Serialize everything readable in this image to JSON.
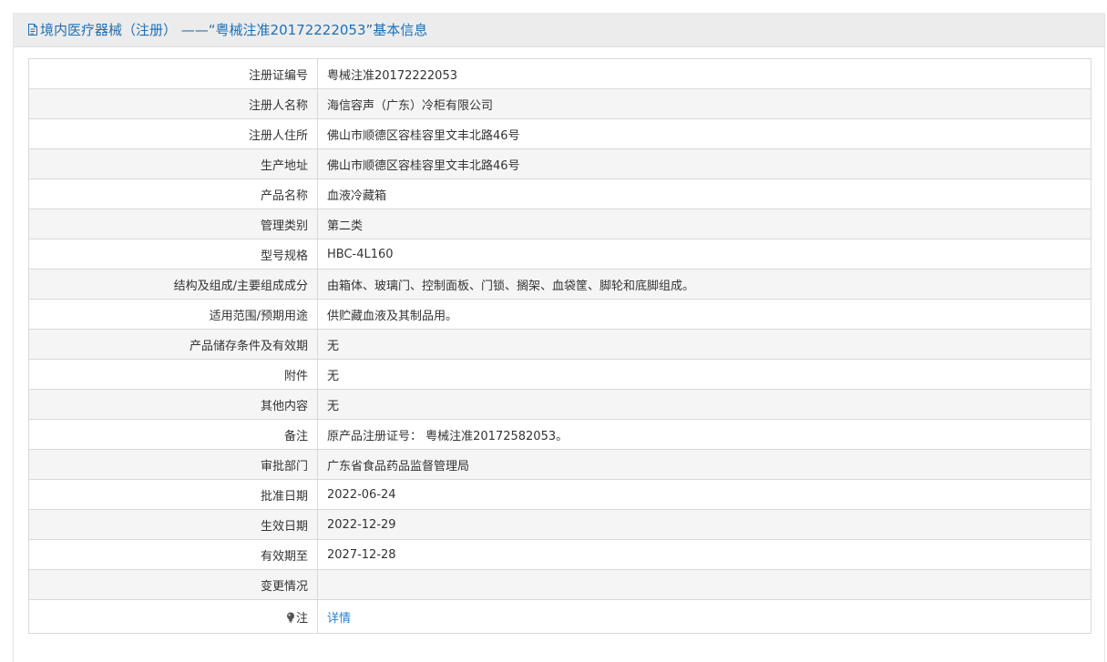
{
  "header": {
    "icon": "document-icon",
    "title": "境内医疗器械（注册） ——“粤械注准20172222053”基本信息"
  },
  "rows": [
    {
      "label": "注册证编号",
      "value": "粤械注准20172222053"
    },
    {
      "label": "注册人名称",
      "value": "海信容声（广东）冷柜有限公司"
    },
    {
      "label": "注册人住所",
      "value": "佛山市顺德区容桂容里文丰北路46号"
    },
    {
      "label": "生产地址",
      "value": "佛山市顺德区容桂容里文丰北路46号"
    },
    {
      "label": "产品名称",
      "value": "血液冷藏箱"
    },
    {
      "label": "管理类别",
      "value": "第二类"
    },
    {
      "label": "型号规格",
      "value": "HBC-4L160"
    },
    {
      "label": "结构及组成/主要组成成分",
      "value": "由箱体、玻璃门、控制面板、门锁、搁架、血袋筐、脚轮和底脚组成。"
    },
    {
      "label": "适用范围/预期用途",
      "value": "供贮藏血液及其制品用。"
    },
    {
      "label": "产品储存条件及有效期",
      "value": "无"
    },
    {
      "label": "附件",
      "value": "无"
    },
    {
      "label": "其他内容",
      "value": "无"
    },
    {
      "label": "备注",
      "value": "原产品注册证号： 粤械注准20172582053。"
    },
    {
      "label": "审批部门",
      "value": "广东省食品药品监督管理局"
    },
    {
      "label": "批准日期",
      "value": "2022-06-24"
    },
    {
      "label": "生效日期",
      "value": "2022-12-29"
    },
    {
      "label": "有效期至",
      "value": "2027-12-28"
    },
    {
      "label": "变更情况",
      "value": ""
    }
  ],
  "note": {
    "icon": "lightbulb-icon",
    "label": "注",
    "link_text": "详情"
  }
}
